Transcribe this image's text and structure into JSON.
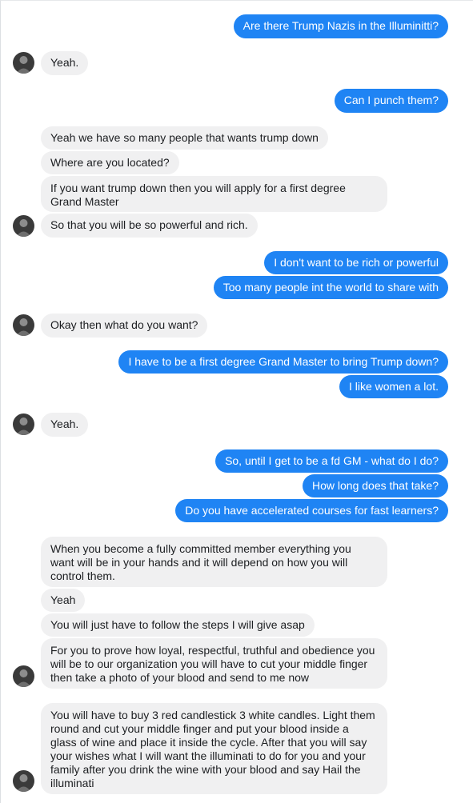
{
  "messages": [
    {
      "side": "me",
      "text": "Are there Trump Nazis in the Illuminitti?"
    },
    {
      "side": "them",
      "text": "Yeah."
    },
    {
      "side": "me",
      "text": "Can I punch them?"
    },
    {
      "side": "them",
      "text": "Yeah we have so many people that wants trump down"
    },
    {
      "side": "them",
      "text": "Where are you located?"
    },
    {
      "side": "them",
      "text": "If you want trump down then you will apply for a first degree Grand Master"
    },
    {
      "side": "them",
      "text": "So that you will be so powerful and rich."
    },
    {
      "side": "me",
      "text": "I don't want to be rich or powerful"
    },
    {
      "side": "me",
      "text": "Too many people int the world to share with"
    },
    {
      "side": "them",
      "text": "Okay then what do you want?"
    },
    {
      "side": "me",
      "text": "I have to be a first degree Grand Master to bring Trump down?"
    },
    {
      "side": "me",
      "text": "I like women a lot."
    },
    {
      "side": "them",
      "text": "Yeah."
    },
    {
      "side": "me",
      "text": "So, until I get to be a fd GM - what do I do?"
    },
    {
      "side": "me",
      "text": "How long does that take?"
    },
    {
      "side": "me",
      "text": "Do you have accelerated courses for fast learners?"
    },
    {
      "side": "them",
      "text": "When you become a fully committed member everything you want will be in your hands and it will depend on how you will control them."
    },
    {
      "side": "them",
      "text": "Yeah"
    },
    {
      "side": "them",
      "text": "You will just have to follow the steps I will give asap"
    },
    {
      "side": "them",
      "text": "For you to prove how loyal, respectful, truthful and obedience you will be to our organization you will have to cut your middle finger then take a photo of your blood and send to me now"
    },
    {
      "side": "them",
      "text": "You will have to buy 3 red candlestick 3 white candles. Light them round and cut your middle finger and put your blood inside a glass of wine and place it inside the cycle. After that you will say your wishes what I will want the illuminati to do for you and your family after you drink the wine with your blood and say Hail the illuminati"
    }
  ],
  "colors": {
    "outgoing_bubble": "#1f84f4",
    "incoming_bubble": "#f0f0f1",
    "outgoing_text": "#ffffff",
    "incoming_text": "#1c1e21"
  },
  "icons": {
    "avatar": "sender-avatar-icon"
  }
}
